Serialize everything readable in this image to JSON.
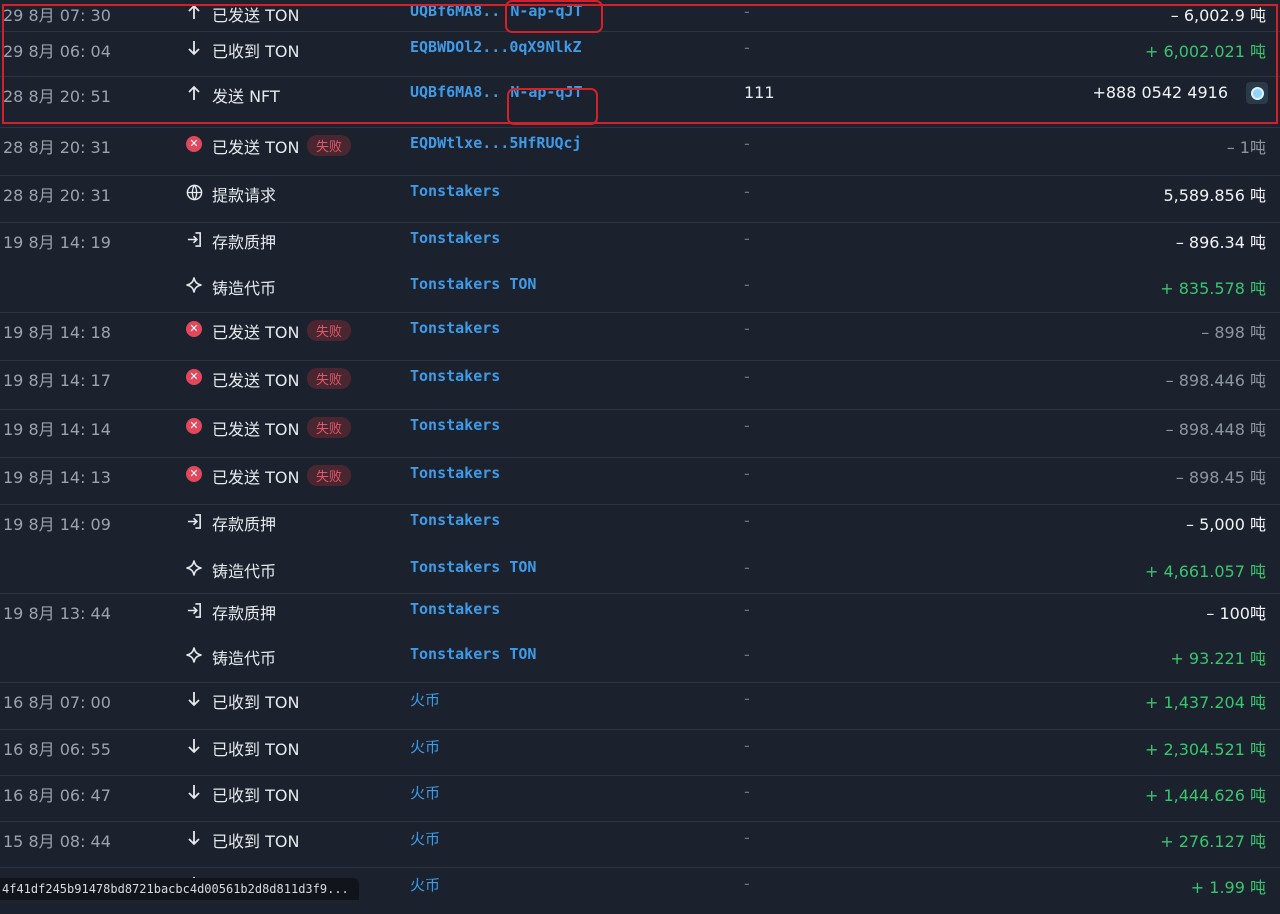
{
  "rows": [
    {
      "time": "29 8月 07: 30",
      "icon": "arrow-up-icon",
      "label": "已发送 TON",
      "address": "UQBf6MA8..",
      "addr_hl": "N-ap-qJT",
      "comment": "-",
      "amount": "– 6,002.9 吨",
      "amount_type": "neg"
    },
    {
      "time": "29 8月 06: 04",
      "icon": "arrow-down-icon",
      "label": "已收到 TON",
      "address": "EQBWDOl2...0qX9NlkZ",
      "comment": "-",
      "amount": "+ 6,002.021 吨",
      "amount_type": "pos"
    },
    {
      "time": "28 8月 20: 51",
      "icon": "arrow-up-icon",
      "label": "发送 NFT",
      "address": "UQBf6MA8..",
      "addr_hl": "N-ap-qJT",
      "comment": "111",
      "amount": "+888 0542 4916",
      "amount_type": "neg"
    },
    {
      "time": "28 8月 20: 31",
      "icon": "failed-x-icon",
      "label": "已发送 TON",
      "fail": "失败",
      "address": "EQDWtlxe...5HfRUQcj",
      "comment": "-",
      "amount": "– 1吨",
      "amount_type": "negfail"
    },
    {
      "time": "28 8月 20: 31",
      "icon": "globe-icon",
      "label": "提款请求",
      "address": "Tonstakers",
      "comment": "-",
      "amount": "5,589.856 吨",
      "amount_type": "neg"
    },
    {
      "time": "19 8月 14: 19",
      "icon": "login-arrow-icon",
      "label": "存款质押",
      "address": "Tonstakers",
      "comment": "-",
      "amount": "– 896.34 吨",
      "amount_type": "neg"
    },
    {
      "time": "",
      "icon": "sparkle-icon",
      "label": "铸造代币",
      "address": "Tonstakers TON",
      "comment": "-",
      "amount": "+ 835.578 吨",
      "amount_type": "pos"
    },
    {
      "time": "19 8月 14: 18",
      "icon": "failed-x-icon",
      "label": "已发送 TON",
      "fail": "失败",
      "address": "Tonstakers",
      "comment": "-",
      "amount": "– 898 吨",
      "amount_type": "negfail"
    },
    {
      "time": "19 8月 14: 17",
      "icon": "failed-x-icon",
      "label": "已发送 TON",
      "fail": "失败",
      "address": "Tonstakers",
      "comment": "-",
      "amount": "– 898.446 吨",
      "amount_type": "negfail"
    },
    {
      "time": "19 8月 14: 14",
      "icon": "failed-x-icon",
      "label": "已发送 TON",
      "fail": "失败",
      "address": "Tonstakers",
      "comment": "-",
      "amount": "– 898.448 吨",
      "amount_type": "negfail"
    },
    {
      "time": "19 8月 14: 13",
      "icon": "failed-x-icon",
      "label": "已发送 TON",
      "fail": "失败",
      "address": "Tonstakers",
      "comment": "-",
      "amount": "– 898.45 吨",
      "amount_type": "negfail"
    },
    {
      "time": "19 8月 14: 09",
      "icon": "login-arrow-icon",
      "label": "存款质押",
      "address": "Tonstakers",
      "comment": "-",
      "amount": "– 5,000 吨",
      "amount_type": "neg"
    },
    {
      "time": "",
      "icon": "sparkle-icon",
      "label": "铸造代币",
      "address": "Tonstakers TON",
      "comment": "-",
      "amount": "+ 4,661.057 吨",
      "amount_type": "pos"
    },
    {
      "time": "19 8月 13: 44",
      "icon": "login-arrow-icon",
      "label": "存款质押",
      "address": "Tonstakers",
      "comment": "-",
      "amount": "– 100吨",
      "amount_type": "neg"
    },
    {
      "time": "",
      "icon": "sparkle-icon",
      "label": "铸造代币",
      "address": "Tonstakers TON",
      "comment": "-",
      "amount": "+ 93.221 吨",
      "amount_type": "pos"
    },
    {
      "time": "16 8月 07: 00",
      "icon": "arrow-down-icon",
      "label": "已收到 TON",
      "address": "火币",
      "comment": "-",
      "amount": "+ 1,437.204 吨",
      "amount_type": "pos"
    },
    {
      "time": "16 8月 06: 55",
      "icon": "arrow-down-icon",
      "label": "已收到 TON",
      "address": "火币",
      "comment": "-",
      "amount": "+ 2,304.521 吨",
      "amount_type": "pos"
    },
    {
      "time": "16 8月 06: 47",
      "icon": "arrow-down-icon",
      "label": "已收到 TON",
      "address": "火币",
      "comment": "-",
      "amount": "+ 1,444.626 吨",
      "amount_type": "pos"
    },
    {
      "time": "15 8月 08: 44",
      "icon": "arrow-down-icon",
      "label": "已收到 TON",
      "address": "火币",
      "comment": "-",
      "amount": "+ 276.127 吨",
      "amount_type": "pos"
    },
    {
      "time": "",
      "icon": "arrow-down-icon",
      "label": "",
      "address": "火币",
      "comment": "-",
      "amount": "+ 1.99 吨",
      "amount_type": "pos"
    }
  ],
  "status_url": "4f41df245b91478bd8721bacbc4d00561b2d8d811d3f9...",
  "colors": {
    "background": "#1b222d",
    "address": "#3f9be8",
    "positive": "#38c56f",
    "fail": "#e2566a",
    "annotation": "#d4202a"
  }
}
